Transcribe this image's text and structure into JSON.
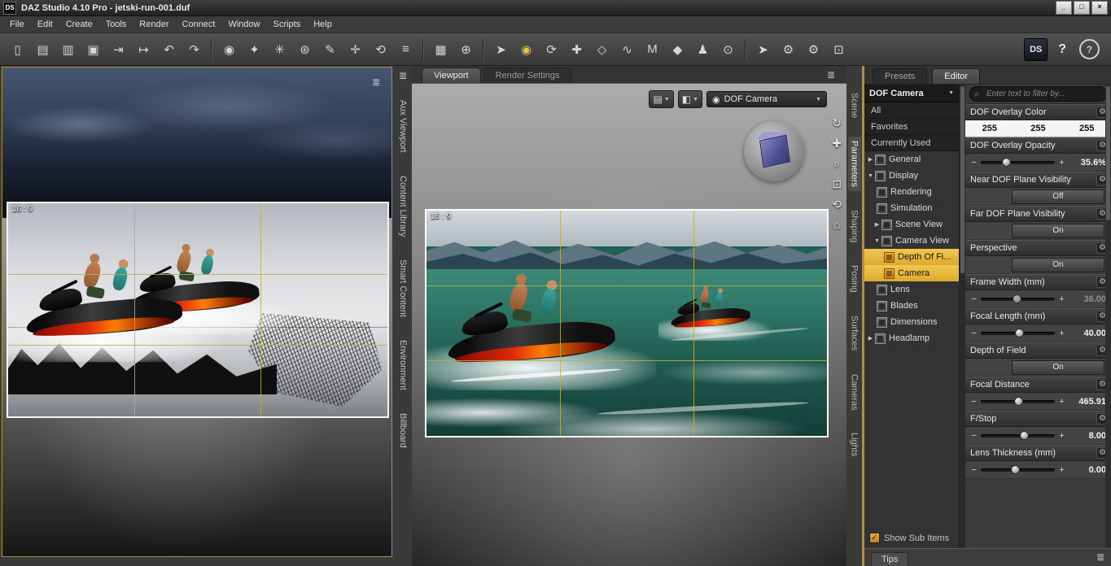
{
  "colors": {
    "selection_yellow": "#e3b33c",
    "accent_orange": "#c8872f",
    "viewport_border": "#ffffff",
    "panel_bg": "#3b3b3b"
  },
  "window": {
    "app_badge": "DS",
    "title": "DAZ Studio 4.10 Pro - jetski-run-001.duf",
    "minimize": "_",
    "maximize": "□",
    "close": "×"
  },
  "menu": {
    "items": [
      "File",
      "Edit",
      "Create",
      "Tools",
      "Render",
      "Connect",
      "Window",
      "Scripts",
      "Help"
    ]
  },
  "toolbar": {
    "icons": [
      "▯",
      "▤",
      "▥",
      "▣",
      "⇥",
      "↦",
      "↶",
      "↷",
      "◉",
      "✦",
      "✳",
      "⊛",
      "✎",
      "✛",
      "⟲",
      "≡",
      "▦",
      "⊕",
      "➤",
      "◉",
      "⟳",
      "✚",
      "◇",
      "∿",
      "M",
      "◆",
      "♟",
      "⊙",
      "➤",
      "⚙",
      "⚙",
      "⊡"
    ],
    "ds_badge": "DS",
    "whats_this": "?",
    "help": "?"
  },
  "left_tabs": [
    "Aux Viewport",
    "Content Library",
    "Smart Content",
    "Environment",
    "Billboard"
  ],
  "right_tabs": [
    "Scene",
    "Parameters",
    "Shaping",
    "Posing",
    "Surfaces",
    "Cameras",
    "Lights"
  ],
  "center": {
    "tabs": [
      "Viewport",
      "Render Settings"
    ],
    "camera_selector": "DOF Camera",
    "aspect_label": "16 : 9",
    "nav_icons": [
      "↻",
      "✚",
      "⌕",
      "⊡",
      "⟲",
      "⌂"
    ]
  },
  "aux": {
    "aspect_label": "16 : 9"
  },
  "params": {
    "tabs": [
      "Presets",
      "Editor"
    ],
    "camera_selector": "DOF Camera",
    "filter_placeholder": "Enter text to filter by...",
    "list_top": [
      "All",
      "Favorites",
      "Currently Used"
    ],
    "tree": [
      {
        "label": "General"
      },
      {
        "label": "Display"
      },
      {
        "label": "Rendering"
      },
      {
        "label": "Simulation"
      },
      {
        "label": "Scene View"
      },
      {
        "label": "Camera View"
      },
      {
        "label": "Depth Of Fi..."
      },
      {
        "label": "Camera"
      },
      {
        "label": "Lens"
      },
      {
        "label": "Blades"
      },
      {
        "label": "Dimensions"
      },
      {
        "label": "Headlamp"
      }
    ],
    "show_sub_items": "Show Sub Items",
    "props": [
      {
        "label": "DOF Overlay Color",
        "values": [
          "255",
          "255",
          "255"
        ]
      },
      {
        "label": "DOF Overlay Opacity",
        "value": "35.6%"
      },
      {
        "label": "Near DOF Plane Visibility",
        "value": "Off"
      },
      {
        "label": "Far DOF Plane Visibility",
        "value": "On"
      },
      {
        "label": "Perspective",
        "value": "On"
      },
      {
        "label": "Frame Width (mm)",
        "value": "36.00"
      },
      {
        "label": "Focal Length (mm)",
        "value": "40.00"
      },
      {
        "label": "Depth of Field",
        "value": "On"
      },
      {
        "label": "Focal Distance",
        "value": "465.91"
      },
      {
        "label": "F/Stop",
        "value": "8.00"
      },
      {
        "label": "Lens Thickness (mm)",
        "value": "0.00"
      }
    ],
    "tips_label": "Tips"
  },
  "icons": {
    "gear": "⚙",
    "minus": "−",
    "plus": "+",
    "chevron_down": "▼",
    "tri_right": "▶",
    "tri_down": "▼",
    "check": "✓",
    "magnifier": "⌕",
    "pane_menu": "≣",
    "style_icon": "▤",
    "shade_icon": "◧",
    "camera_glyph": "◉"
  }
}
